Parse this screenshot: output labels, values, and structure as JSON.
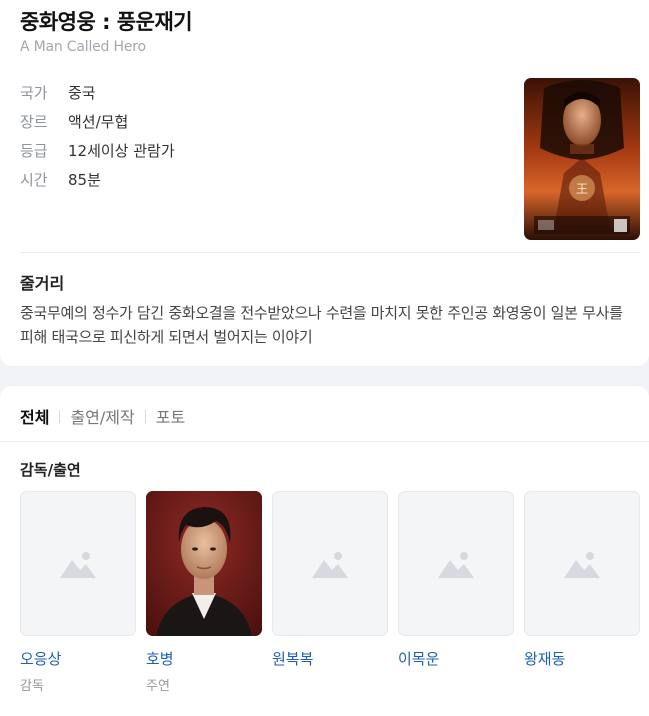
{
  "movie": {
    "title": "중화영웅 : 풍운재기",
    "original_title": "A Man Called Hero",
    "info": [
      {
        "key": "국가",
        "value": "중국"
      },
      {
        "key": "장르",
        "value": "액션/무협"
      },
      {
        "key": "등급",
        "value": "12세이상 관람가"
      },
      {
        "key": "시간",
        "value": "85분"
      }
    ],
    "poster_icon": "movie-poster"
  },
  "synopsis": {
    "heading": "줄거리",
    "text": "중국무예의 정수가 담긴 중화오결을 전수받았으나 수련을 마치지 못한 주인공 화영웅이 일본 무사를 피해 태국으로 피신하게 되면서 벌어지는 이야기"
  },
  "tabs": [
    "전체",
    "출연/제작",
    "포토"
  ],
  "cast": {
    "heading": "감독/출연",
    "people": [
      {
        "name": "오응상",
        "role": "감독",
        "photo": false
      },
      {
        "name": "호병",
        "role": "주연",
        "photo": true
      },
      {
        "name": "원복복",
        "role": "",
        "photo": false
      },
      {
        "name": "이목운",
        "role": "",
        "photo": false
      },
      {
        "name": "왕재동",
        "role": "",
        "photo": false
      }
    ],
    "placeholder_icon": "image-placeholder-icon"
  },
  "colors": {
    "link": "#1f5fb5",
    "label": "#8f959c",
    "page_bg": "#f1f3f6"
  }
}
